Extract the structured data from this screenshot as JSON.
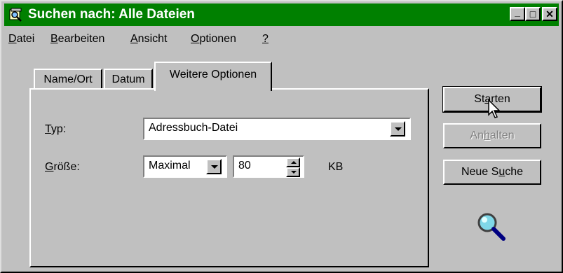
{
  "window": {
    "title": "Suchen nach: Alle Dateien",
    "controls": {
      "minimize": "_",
      "maximize": "□",
      "close": "✕"
    }
  },
  "menu": {
    "items": [
      {
        "u": "D",
        "rest": "atei"
      },
      {
        "u": "B",
        "rest": "earbeiten"
      },
      {
        "u": "A",
        "rest": "nsicht"
      },
      {
        "u": "O",
        "rest": "ptionen"
      },
      {
        "u": "?",
        "rest": ""
      }
    ]
  },
  "tabs": [
    {
      "label": "Name/Ort"
    },
    {
      "label": "Datum"
    },
    {
      "label": "Weitere Optionen",
      "active": true
    }
  ],
  "form": {
    "type_label_u": "T",
    "type_label_rest": "yp:",
    "type_value": "Adressbuch-Datei",
    "size_label_u": "G",
    "size_label_rest": "röße:",
    "size_mode": "Maximal",
    "size_value": "80",
    "size_unit": "KB"
  },
  "buttons": {
    "start": {
      "pre": "St",
      "u": "a",
      "post": "rten"
    },
    "stop": {
      "pre": "An",
      "u": "h",
      "post": "alten",
      "disabled": true
    },
    "new_search": {
      "pre": "Neue S",
      "u": "u",
      "post": "che"
    }
  },
  "icons": {
    "app": "search-app-icon",
    "magnifier": "magnifier-icon",
    "cursor": "mouse-cursor-icon"
  }
}
